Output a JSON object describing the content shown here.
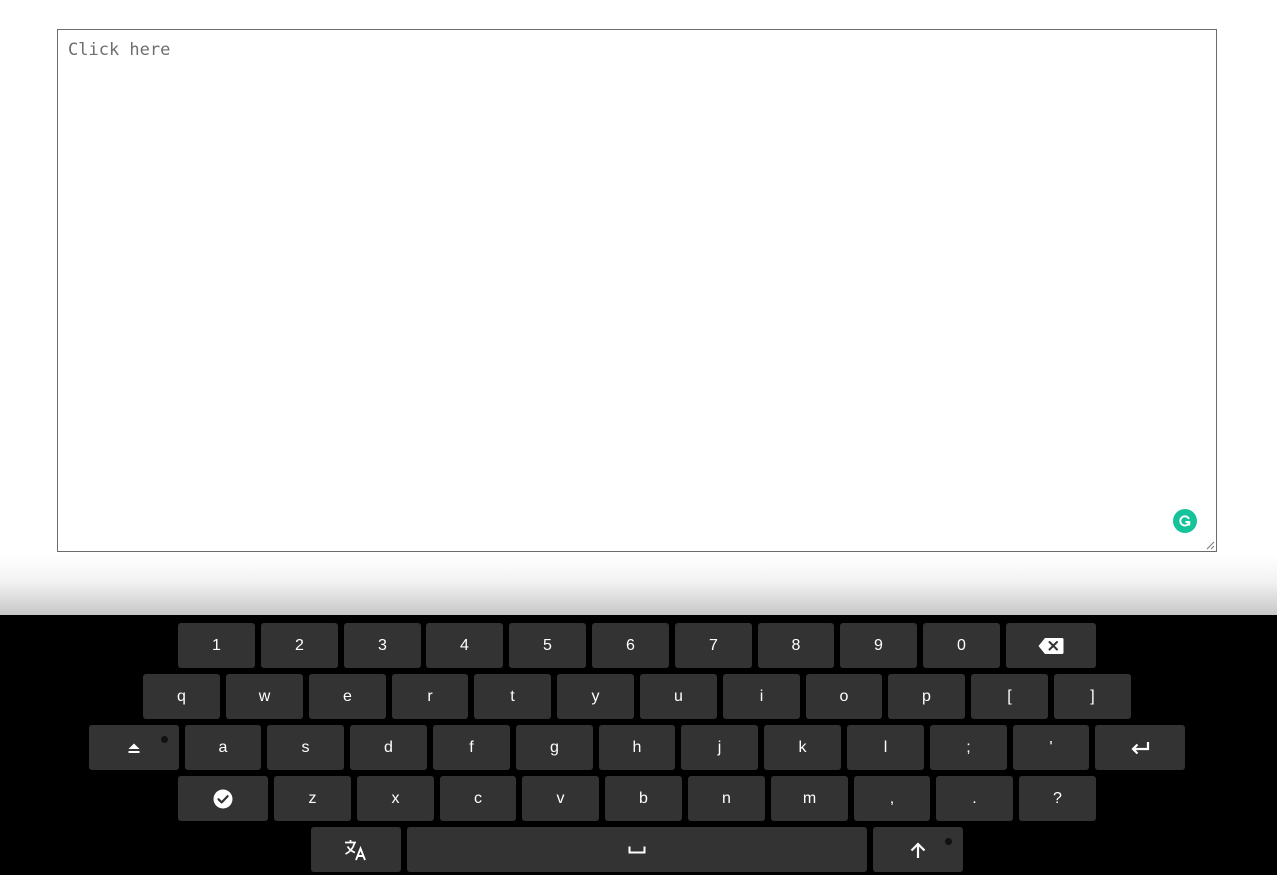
{
  "editor": {
    "placeholder": "Click here",
    "value": ""
  },
  "keyboard": {
    "row1": [
      "1",
      "2",
      "3",
      "4",
      "5",
      "6",
      "7",
      "8",
      "9",
      "0"
    ],
    "row2": [
      "q",
      "w",
      "e",
      "r",
      "t",
      "y",
      "u",
      "i",
      "o",
      "p",
      "[",
      "]"
    ],
    "row3": [
      "a",
      "s",
      "d",
      "f",
      "g",
      "h",
      "j",
      "k",
      "l",
      ";",
      "'"
    ],
    "row4": [
      "z",
      "x",
      "c",
      "v",
      "b",
      "n",
      "m",
      ",",
      ".",
      "?"
    ]
  },
  "colors": {
    "keyboard_bg": "#000000",
    "key_bg": "#333333",
    "key_text": "#ffffff",
    "grammarly": "#15c39a"
  },
  "icons": {
    "backspace": "backspace-icon",
    "layout_switch": "layout-switch-icon",
    "enter": "enter-icon",
    "done": "check-circle-icon",
    "language": "translate-icon",
    "space": "space-icon",
    "shift": "shift-icon",
    "grammarly": "grammarly-icon"
  }
}
